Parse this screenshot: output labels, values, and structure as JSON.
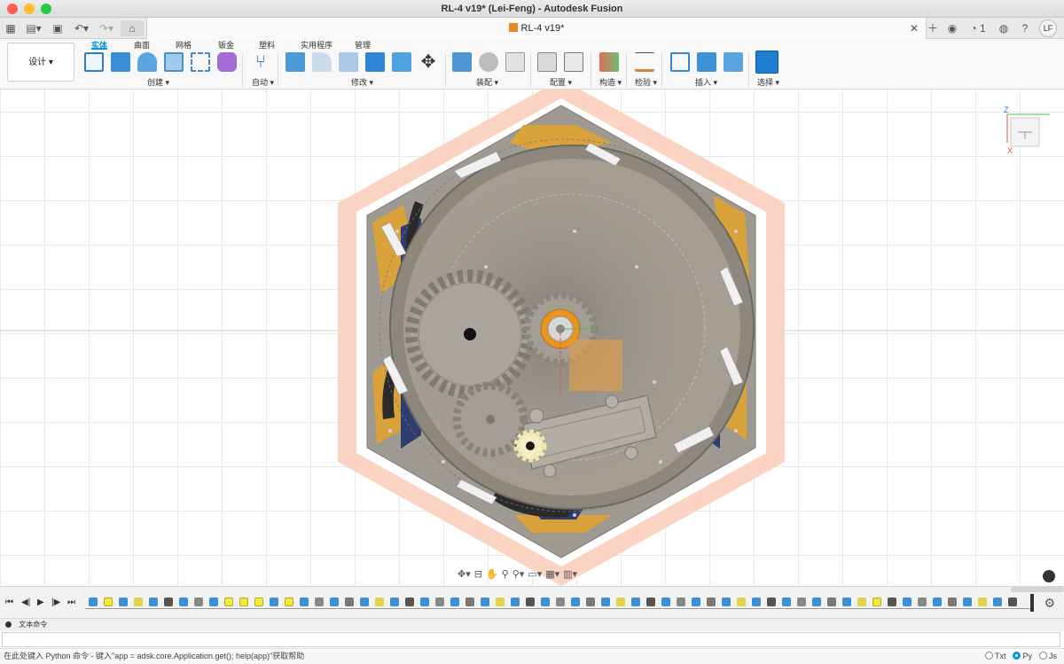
{
  "window": {
    "title": "RL-4 v19* (Lei-Feng) - Autodesk Fusion"
  },
  "tabbar": {
    "doc_tab": "RL-4 v19*",
    "jobs_count": "1",
    "user_initials": "LF"
  },
  "ribbon": {
    "workspace": "设计 ▾",
    "tabs": [
      "实体",
      "曲面",
      "网格",
      "钣金",
      "塑料",
      "实用程序",
      "管理"
    ],
    "groups": [
      "创建 ▾",
      "自动 ▾",
      "修改 ▾",
      "装配 ▾",
      "配置 ▾",
      "构造 ▾",
      "检验 ▾",
      "插入 ▾",
      "选择 ▾"
    ]
  },
  "viewcube": {
    "axis_z": "Z",
    "axis_x": "X"
  },
  "command_panel": {
    "header": "文本命令",
    "status_hint": "在此处键入 Python 命令 - 键入\"app = adsk.core.Application.get(); help(app)\"获取帮助",
    "languages": [
      "Txt",
      "Py",
      "Js"
    ],
    "selected_language": "Py"
  },
  "colors": {
    "accent": "#0696d7",
    "hex_outline": "#f9c9b6",
    "body_gray": "#8d877c",
    "gold": "#d9a23a",
    "navy": "#2f3d6e"
  }
}
